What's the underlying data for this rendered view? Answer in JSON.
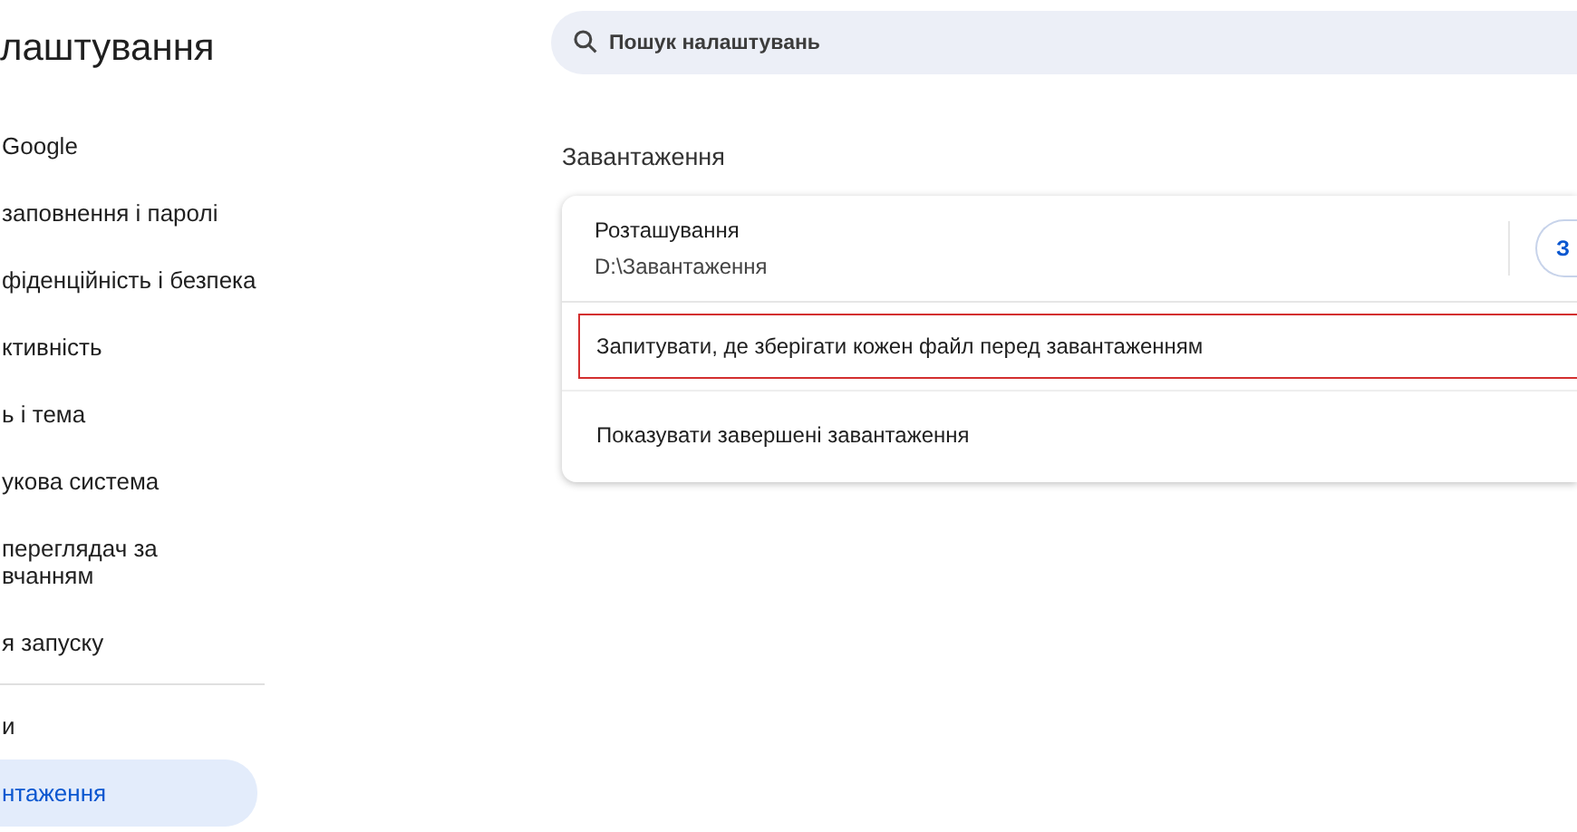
{
  "sidebar": {
    "title": "лаштування",
    "groups": [
      [
        {
          "lines": [
            "Google"
          ],
          "selected": false
        },
        {
          "lines": [
            "заповнення і паролі"
          ],
          "selected": false
        },
        {
          "lines": [
            "фіденційність і безпека"
          ],
          "selected": false
        },
        {
          "lines": [
            "ктивність"
          ],
          "selected": false
        },
        {
          "lines": [
            "ь і тема"
          ],
          "selected": false
        },
        {
          "lines": [
            "укова система"
          ],
          "selected": false
        },
        {
          "lines": [
            "переглядач за",
            "вчанням"
          ],
          "selected": false
        },
        {
          "lines": [
            "я запуску"
          ],
          "selected": false
        }
      ],
      [
        {
          "lines": [
            "и"
          ],
          "selected": false
        },
        {
          "lines": [
            "нтаження"
          ],
          "selected": true
        }
      ]
    ]
  },
  "search": {
    "placeholder": "Пошук налаштувань"
  },
  "section": {
    "title": "Завантаження",
    "rows": [
      {
        "kind": "location",
        "label": "Розташування",
        "value": "D:\\Завантаження",
        "button": "З"
      },
      {
        "kind": "toggle",
        "label": "Запитувати, де зберігати кожен файл перед завантаженням",
        "highlighted": true
      },
      {
        "kind": "toggle",
        "label": "Показувати завершені завантаження",
        "highlighted": false
      }
    ]
  }
}
